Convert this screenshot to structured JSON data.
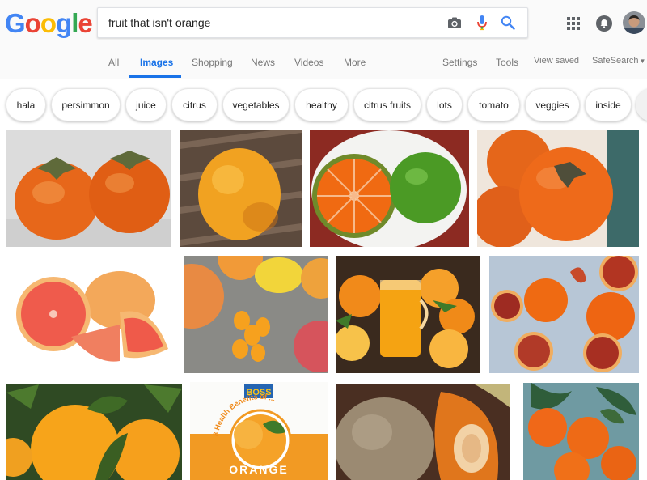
{
  "logo": {
    "letters": [
      "G",
      "o",
      "o",
      "g",
      "l",
      "e"
    ],
    "colors": [
      "#4285F4",
      "#EA4335",
      "#FBBC05",
      "#4285F4",
      "#34A853",
      "#EA4335"
    ]
  },
  "search": {
    "query": "fruit that isn't orange",
    "placeholder": ""
  },
  "tabs": {
    "all": "All",
    "images": "Images",
    "shopping": "Shopping",
    "news": "News",
    "videos": "Videos",
    "more": "More",
    "settings": "Settings",
    "tools": "Tools",
    "view_saved": "View saved",
    "safesearch": "SafeSearch"
  },
  "chips": [
    "hala",
    "persimmon",
    "juice",
    "citrus",
    "vegetables",
    "healthy",
    "citrus fruits",
    "lots",
    "tomato",
    "veggies",
    "inside"
  ],
  "image_text": {
    "boss": "BOSS",
    "health_arc": "8 Health Benefits of ...",
    "orange_word": "ORANGE"
  },
  "colors": {
    "accent": "#1a73e8",
    "tab_inactive": "#777777"
  },
  "icons": {
    "camera": "camera-icon",
    "mic": "microphone-icon",
    "search": "search-icon",
    "apps": "apps-grid-icon",
    "notifications": "notifications-icon"
  }
}
